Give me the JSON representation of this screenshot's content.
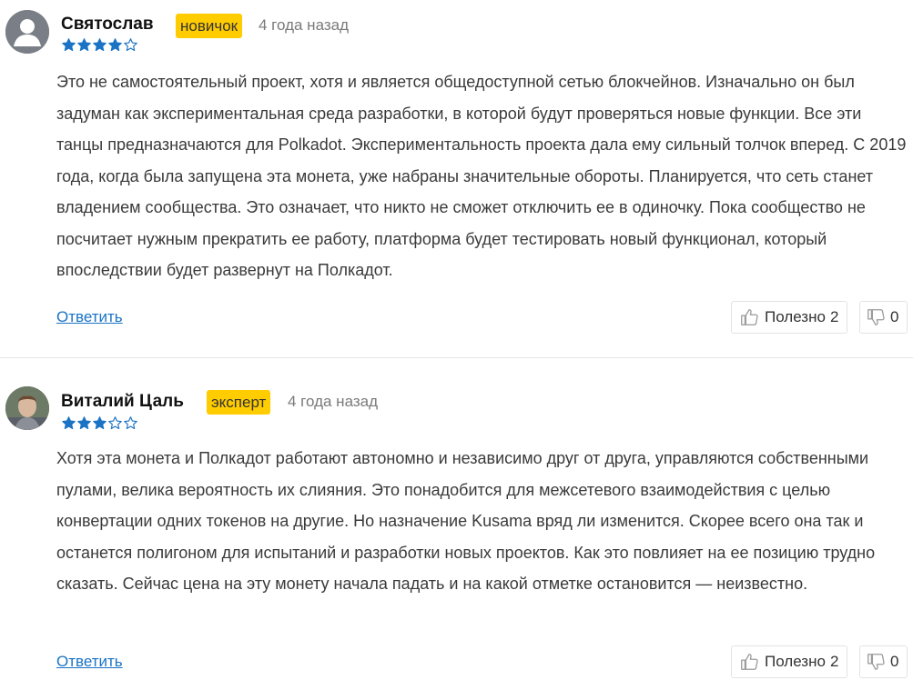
{
  "comments": [
    {
      "author": "Святослав",
      "badge": "новичок",
      "date": "4 года назад",
      "rating": 4,
      "text": "Это не самостоятельный проект, хотя и является общедоступной сетью блокчейнов. Изначально он был задуман как экспериментальная среда разработки, в которой будут проверяться новые функции. Все эти танцы предназначаются для Polkadot. Экспериментальность проекта дала ему сильный толчок вперед. С 2019 года, когда была запущена эта монета, уже набраны значительные обороты. Планируется, что сеть станет владением сообщества. Это означает, что никто не сможет отключить ее в одиночку. Пока сообщество не посчитает нужным прекратить ее работу, платформа будет тестировать новый функционал, который впоследствии будет развернут на Полкадот.",
      "reply_label": "Ответить",
      "helpful_label": "Полезно",
      "helpful_count": "2",
      "unhelpful_count": "0"
    },
    {
      "author": "Виталий Цаль",
      "badge": "эксперт",
      "date": "4 года назад",
      "rating": 3,
      "text": "Хотя эта монета и Полкадот работают автономно и независимо друг от друга, управляются собственными пулами, велика вероятность их слияния. Это понадобится для межсетевого взаимодействия с целью конвертации одних токенов на другие. Но назначение Kusama вряд ли изменится. Скорее всего она так и останется полигоном для испытаний и разработки новых проектов. Как это повлияет на ее позицию трудно сказать. Сейчас цена на эту монету начала падать и на какой отметке остановится — неизвестно.",
      "reply_label": "Ответить",
      "helpful_label": "Полезно",
      "helpful_count": "2",
      "unhelpful_count": "0"
    }
  ],
  "colors": {
    "badge_bg": "#ffcc00",
    "star_fill": "#1a73c4",
    "link": "#1a73c4"
  },
  "icons": {
    "avatar_placeholder": "user-silhouette-icon",
    "thumbs_up": "thumbs-up-icon",
    "thumbs_down": "thumbs-down-icon",
    "star": "star-icon"
  }
}
